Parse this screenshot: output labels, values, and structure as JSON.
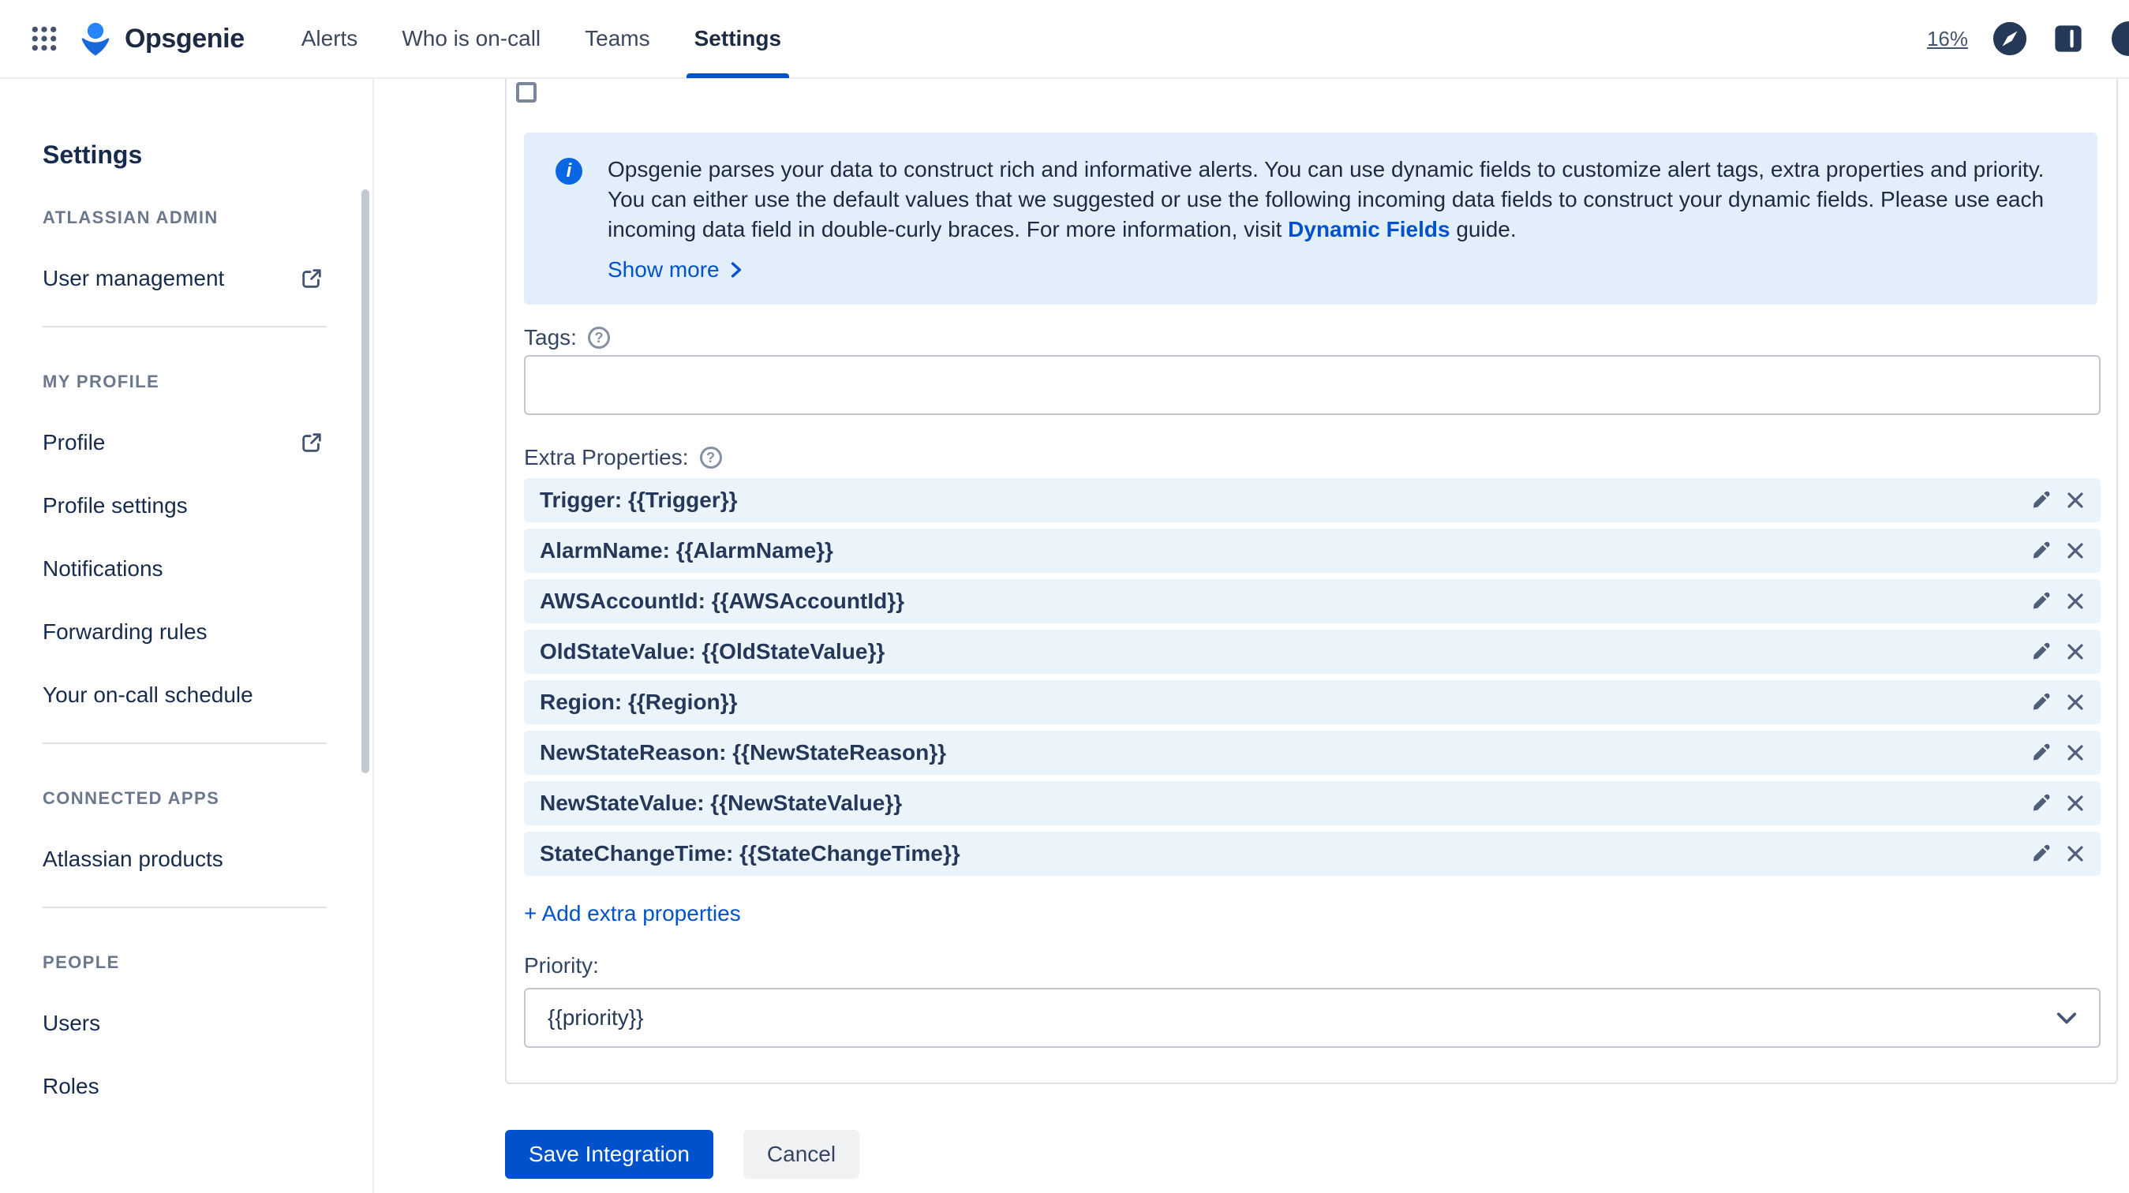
{
  "header": {
    "brand": "Opsgenie",
    "nav": [
      {
        "label": "Alerts"
      },
      {
        "label": "Who is on-call"
      },
      {
        "label": "Teams"
      },
      {
        "label": "Settings"
      }
    ],
    "zoom_indicator": "16%"
  },
  "sidebar": {
    "title": "Settings",
    "sections": [
      {
        "heading": "ATLASSIAN ADMIN",
        "items": [
          {
            "label": "User management"
          }
        ]
      },
      {
        "heading": "MY PROFILE",
        "items": [
          {
            "label": "Profile"
          },
          {
            "label": "Profile settings"
          },
          {
            "label": "Notifications"
          },
          {
            "label": "Forwarding rules"
          },
          {
            "label": "Your on-call schedule"
          }
        ]
      },
      {
        "heading": "CONNECTED APPS",
        "items": [
          {
            "label": "Atlassian products"
          }
        ]
      },
      {
        "heading": "PEOPLE",
        "items": [
          {
            "label": "Users"
          },
          {
            "label": "Roles"
          }
        ]
      }
    ]
  },
  "form": {
    "info": {
      "text": "Opsgenie parses your data to construct rich and informative alerts. You can use dynamic fields to customize alert tags, extra properties and priority. You can either use the default values that we suggested or use the following incoming data fields to construct your dynamic fields. Please use each incoming data field in double-curly braces. For more information, visit ",
      "link_text": "Dynamic Fields",
      "suffix": " guide.",
      "show_more": "Show more"
    },
    "tags": {
      "label": "Tags:",
      "value": ""
    },
    "extra_properties": {
      "label": "Extra Properties:",
      "rows": [
        "Trigger: {{Trigger}}",
        "AlarmName: {{AlarmName}}",
        "AWSAccountId: {{AWSAccountId}}",
        "OldStateValue: {{OldStateValue}}",
        "Region: {{Region}}",
        "NewStateReason: {{NewStateReason}}",
        "NewStateValue: {{NewStateValue}}",
        "StateChangeTime: {{StateChangeTime}}"
      ],
      "add_button": "+ Add extra properties"
    },
    "priority": {
      "label": "Priority:",
      "value": "{{priority}}"
    },
    "actions": {
      "save": "Save Integration",
      "cancel": "Cancel"
    }
  },
  "icons": {
    "app-switcher-icon": "grid-of-dots",
    "opsgenie-logo-icon": "blue-genie-mark",
    "compass-icon": "dark-circle-compass",
    "journal-icon": "dark-book",
    "external-link-icon": "box-with-arrow",
    "info-icon": "blue-circle-i",
    "help-icon": "circle-question",
    "edit-icon": "pencil",
    "remove-icon": "x-cross",
    "chevron-down-icon": "v",
    "chevron-right-icon": ">"
  },
  "colors": {
    "accent": "#0052CC",
    "nav_underline": "#0052CC",
    "info_panel_bg": "#E3EEFB",
    "property_row_bg": "#EBF3FB",
    "save_button_bg": "#0052CC"
  }
}
